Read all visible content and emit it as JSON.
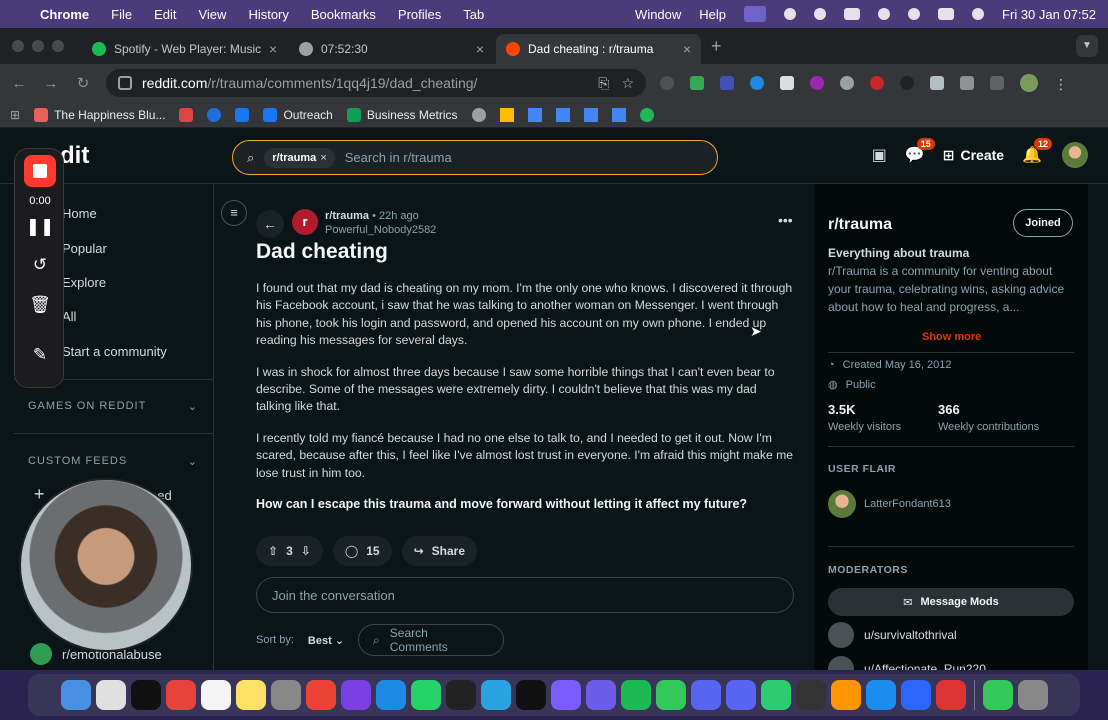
{
  "menubar": {
    "app": "Chrome",
    "items": [
      "File",
      "Edit",
      "View",
      "History",
      "Bookmarks",
      "Profiles",
      "Tab"
    ],
    "right_items": [
      "Window",
      "Help"
    ],
    "clock": "Fri 30 Jan  07:52"
  },
  "tabs": [
    {
      "title": "Spotify - Web Player: Music fo",
      "color": "#1db954"
    },
    {
      "title": "07:52:30",
      "color": "#9aa0a6"
    },
    {
      "title": "Dad cheating : r/trauma",
      "color": "#ff4500"
    }
  ],
  "address": {
    "host": "reddit.com",
    "path": "/r/trauma/comments/1qq4j19/dad_cheating/"
  },
  "bookmarks": [
    {
      "label": "The Happiness Blu...",
      "color": "#e8615a"
    },
    {
      "label": "",
      "color": "#d44"
    },
    {
      "label": "",
      "color": "#1877f2"
    },
    {
      "label": "",
      "color": "#1877f2"
    },
    {
      "label": "Outreach",
      "color": "#1877f2"
    },
    {
      "label": "Business Metrics",
      "color": "#0f9d58"
    }
  ],
  "reddit": {
    "logo": "dit",
    "search": {
      "chip": "r/trauma",
      "placeholder": "Search in r/trauma"
    },
    "header": {
      "chat_badge": "15",
      "create": "Create",
      "notif_badge": "12"
    },
    "nav": {
      "items": [
        "Home",
        "Popular",
        "Explore",
        "All",
        "Start a community"
      ],
      "games": "GAMES ON REDDIT",
      "custom": "CUSTOM FEEDS",
      "create_feed": "eed",
      "community": "r/emotionalabuse"
    },
    "recorder": {
      "time": "0:00"
    },
    "post": {
      "subreddit": "r/trauma",
      "age": "22h ago",
      "author": "Powerful_Nobody2582",
      "title": "Dad cheating",
      "paragraphs": [
        "I found out that my dad is cheating on my mom. I'm the only one who knows. I discovered it through his Facebook account, i saw that he was talking to another woman on Messenger. I went through his phone, took his login and password, and opened his account on my own phone. I ended up reading his messages for several days.",
        "I was in shock for almost three days because I saw some horrible things that I can't even bear to describe. Some of the messages were extremely dirty. I couldn't believe that this was my dad talking like that.",
        "I recently told my fiancé because I had no one else to talk to, and I needed to get it out. Now I'm scared, because after this, I feel like I've almost lost trust in everyone. I'm afraid this might make me lose trust in him too."
      ],
      "question": "How can I escape this trauma and move forward without letting it affect my future?",
      "votes": "3",
      "comments": "15",
      "share": "Share",
      "join_placeholder": "Join the conversation",
      "sort_label": "Sort by:",
      "sort_value": "Best",
      "search_comments": "Search Comments"
    },
    "sidebar": {
      "name": "r/trauma",
      "joined": "Joined",
      "tagline": "Everything about trauma",
      "description": "r/Trauma is a community for venting about your trauma, celebrating wins, asking advice about how to heal and progress, a...",
      "show_more": "Show more",
      "created": "Created May 16, 2012",
      "visibility": "Public",
      "visitors_n": "3.5K",
      "visitors_l": "Weekly visitors",
      "contrib_n": "366",
      "contrib_l": "Weekly contributions",
      "user_flair": "USER FLAIR",
      "flair_user": "LatterFondant613",
      "moderators": "MODERATORS",
      "message_mods": "Message Mods",
      "mods": [
        "u/survivaltothrival",
        "u/Affectionate_Run220"
      ]
    }
  },
  "dock_colors": [
    "#4a90e2",
    "#e0e0e0",
    "#111",
    "#e8433b",
    "#f5f5f5",
    "#ffe066",
    "#888",
    "#ea4335",
    "#7b3fe4",
    "#1e88e5",
    "#25d366",
    "#222",
    "#2aa3e0",
    "#111",
    "#7b5cff",
    "#6c5ce7",
    "#1db954",
    "#34c759",
    "#5865f2",
    "#5865f2",
    "#2ecc71",
    "#333",
    "#ff9500",
    "#1c8cf0",
    "#2b66ff",
    "#d33",
    "#34c759",
    "#888"
  ]
}
